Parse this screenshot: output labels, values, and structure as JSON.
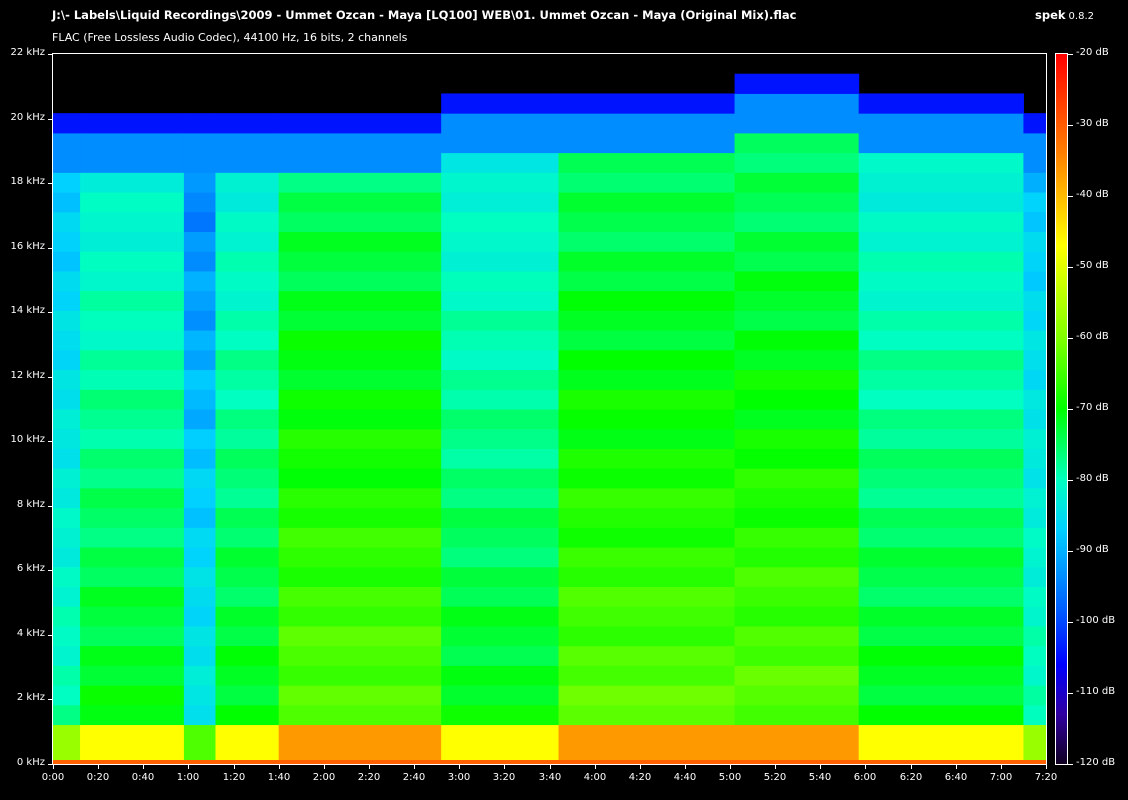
{
  "window": {
    "title": "J:\\- Labels\\Liquid Recordings\\2009 - Ummet Ozcan - Maya [LQ100] WEB\\01. Ummet Ozcan - Maya (Original Mix).flac",
    "subtitle": "FLAC (Free Lossless Audio Codec), 44100 Hz, 16 bits, 2 channels",
    "app_name": "spek",
    "app_version": "0.8.2"
  },
  "chart_data": {
    "type": "heatmap",
    "title": "J:\\- Labels\\Liquid Recordings\\2009 - Ummet Ozcan - Maya [LQ100] WEB\\01. Ummet Ozcan - Maya (Original Mix).flac",
    "xlabel": "",
    "ylabel": "",
    "x_ticks": [
      "0:00",
      "0:20",
      "0:40",
      "1:00",
      "1:20",
      "1:40",
      "2:00",
      "2:20",
      "2:40",
      "3:00",
      "3:20",
      "3:40",
      "4:00",
      "4:20",
      "4:40",
      "5:00",
      "5:20",
      "5:40",
      "6:00",
      "6:20",
      "6:40",
      "7:00",
      "7:20"
    ],
    "y_ticks": [
      "0 kHz",
      "2 kHz",
      "4 kHz",
      "6 kHz",
      "8 kHz",
      "10 kHz",
      "12 kHz",
      "14 kHz",
      "16 kHz",
      "18 kHz",
      "20 kHz",
      "22 kHz"
    ],
    "x_range_seconds": [
      0,
      440
    ],
    "y_range_khz": [
      0,
      22
    ],
    "colorbar": {
      "labels": [
        "-20 dB",
        "-30 dB",
        "-40 dB",
        "-50 dB",
        "-60 dB",
        "-70 dB",
        "-80 dB",
        "-90 dB",
        "-100 dB",
        "-110 dB",
        "-120 dB"
      ],
      "range_db": [
        -120,
        -20
      ],
      "colors": [
        "#ff0000",
        "#ff8000",
        "#ffff00",
        "#80ff00",
        "#00ff00",
        "#00ffc0",
        "#00d0ff",
        "#0060ff",
        "#0000ff",
        "#3000a0",
        "#100020"
      ]
    },
    "sections": [
      {
        "start_s": 0,
        "end_s": 12,
        "energy": "low",
        "cutoff_khz": 19
      },
      {
        "start_s": 12,
        "end_s": 58,
        "energy": "mid",
        "cutoff_khz": 19
      },
      {
        "start_s": 58,
        "end_s": 72,
        "energy": "dip",
        "cutoff_khz": 19
      },
      {
        "start_s": 72,
        "end_s": 100,
        "energy": "mid",
        "cutoff_khz": 19
      },
      {
        "start_s": 100,
        "end_s": 172,
        "energy": "high",
        "cutoff_khz": 19.5
      },
      {
        "start_s": 172,
        "end_s": 224,
        "energy": "mid",
        "cutoff_khz": 20
      },
      {
        "start_s": 224,
        "end_s": 302,
        "energy": "high",
        "cutoff_khz": 20
      },
      {
        "start_s": 302,
        "end_s": 357,
        "energy": "high",
        "cutoff_khz": 20.5
      },
      {
        "start_s": 357,
        "end_s": 430,
        "energy": "mid",
        "cutoff_khz": 20
      },
      {
        "start_s": 430,
        "end_s": 440,
        "energy": "low",
        "cutoff_khz": 19
      }
    ]
  }
}
